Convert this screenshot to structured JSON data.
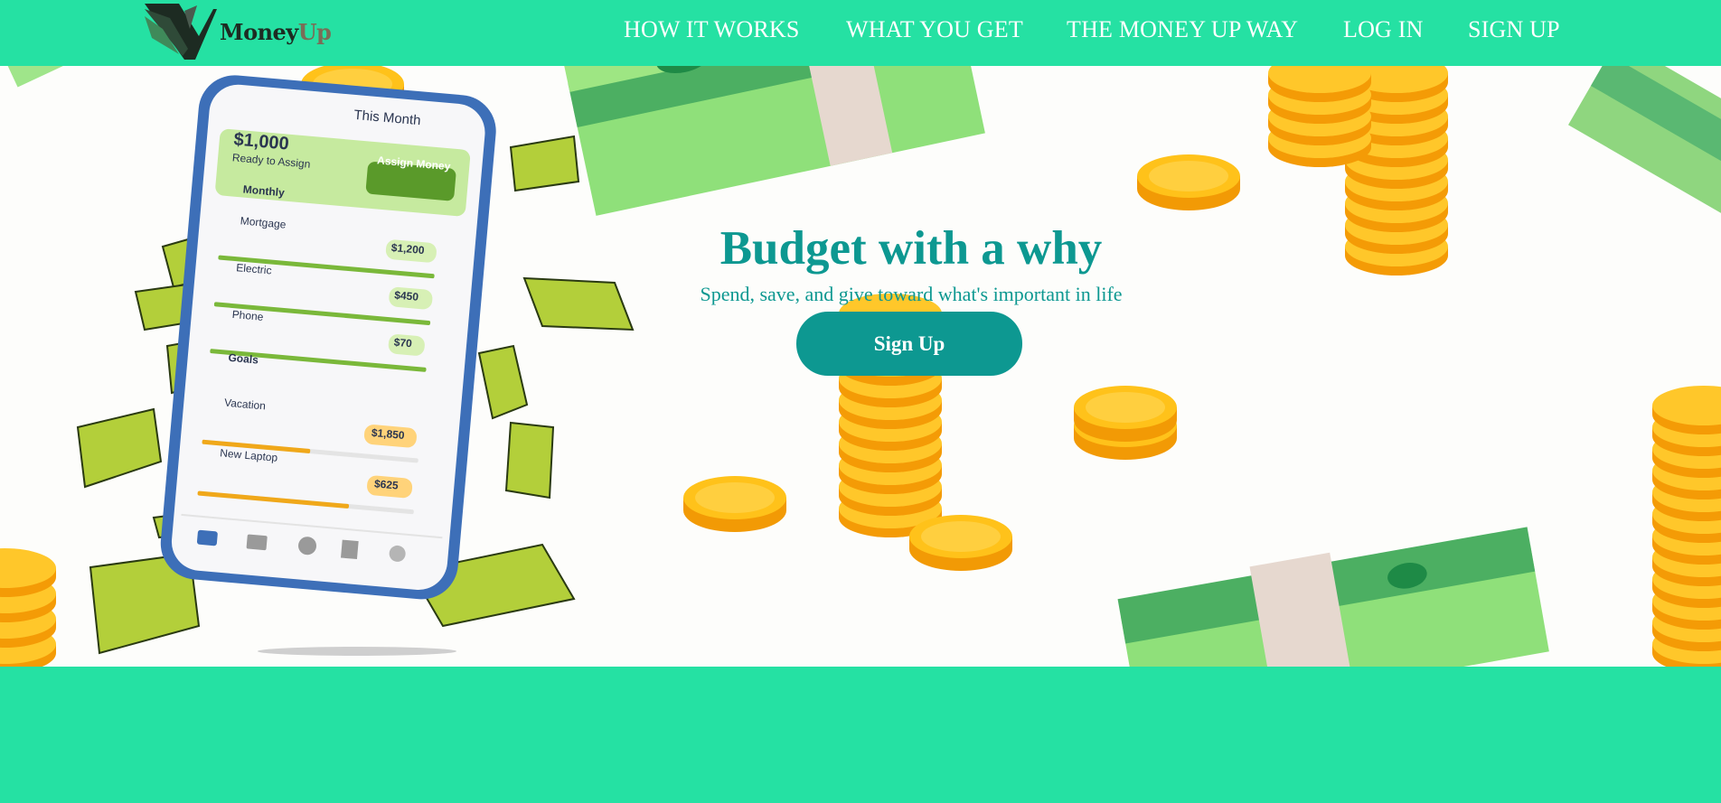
{
  "brand": {
    "name_part1": "Money",
    "name_part2": "Up"
  },
  "nav": {
    "how_it_works": "HOW IT WORKS",
    "what_you_get": "WHAT YOU GET",
    "money_up_way": "THE MONEY UP WAY",
    "log_in": "LOG IN",
    "sign_up": "SIGN UP"
  },
  "hero": {
    "title": "Budget with a why",
    "subtitle": "Spend, save, and give toward what's important in life",
    "cta_label": "Sign Up"
  },
  "phone": {
    "header": "This Month",
    "ready_amount": "$1,000",
    "ready_label": "Ready to Assign",
    "assign_button": "Assign Money",
    "groups": [
      {
        "name": "Monthly",
        "items": [
          {
            "label": "Mortgage",
            "amount": "$1,200",
            "progress": 1.0
          },
          {
            "label": "Electric",
            "amount": "$450",
            "progress": 1.0
          },
          {
            "label": "Phone",
            "amount": "$70",
            "progress": 1.0
          }
        ]
      },
      {
        "name": "Goals",
        "items": [
          {
            "label": "Vacation",
            "amount": "$1,850",
            "progress": 0.5
          },
          {
            "label": "New Laptop",
            "amount": "$625",
            "progress": 0.7
          }
        ]
      }
    ],
    "tab_icons": [
      "home-icon",
      "bank-icon",
      "add-icon",
      "reports-icon",
      "help-icon"
    ]
  },
  "colors": {
    "brand_green": "#25e1a3",
    "teal": "#0d9891",
    "coin": "#ffc21a",
    "bill": "#5bbf72"
  }
}
